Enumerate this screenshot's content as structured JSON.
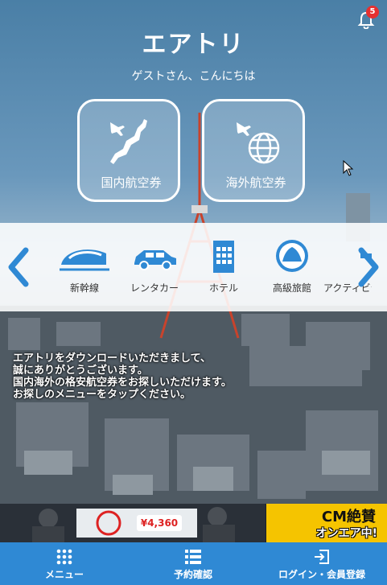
{
  "app": {
    "logo": "エアトリ",
    "greeting": "ゲストさん、こんにちは"
  },
  "notifications": {
    "count": "5",
    "icon": "bell-icon"
  },
  "flight_buttons": [
    {
      "label": "国内航空券",
      "icon": "japan-plane-icon"
    },
    {
      "label": "海外航空券",
      "icon": "globe-plane-icon"
    }
  ],
  "categories": [
    {
      "label": "新幹線",
      "icon": "bullet-train-icon"
    },
    {
      "label": "レンタカー",
      "icon": "car-icon"
    },
    {
      "label": "ホテル",
      "icon": "hotel-icon"
    },
    {
      "label": "高級旅館",
      "icon": "ryokan-icon"
    },
    {
      "label": "アクティビティ",
      "icon": "activity-icon"
    }
  ],
  "message": {
    "lines": [
      "エアトリをダウンロードいただきまして、",
      "誠にありがとうございます。",
      "国内海外の格安航空券をお探しいただけます。",
      "お探しのメニューをタップください。"
    ]
  },
  "banner": {
    "price": "¥4,360",
    "cm_line1": "CM絶賛",
    "cm_line2": "オンエア中!"
  },
  "nav": [
    {
      "label": "メニュー",
      "icon": "grid-icon"
    },
    {
      "label": "予約確認",
      "icon": "list-icon"
    },
    {
      "label": "ログイン・会員登録",
      "icon": "login-icon"
    }
  ],
  "colors": {
    "accent": "#2f89d4",
    "badge": "#e63030",
    "arrow": "#2f89d4",
    "banner_yellow": "#f5c400"
  }
}
